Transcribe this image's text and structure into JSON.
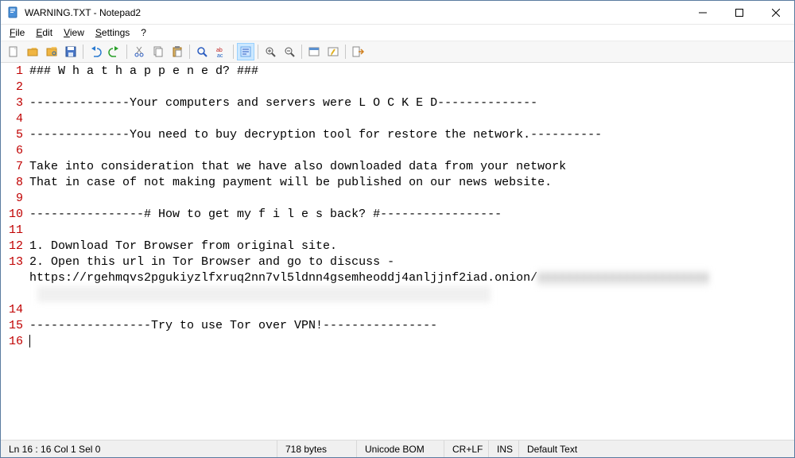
{
  "window": {
    "title": "WARNING.TXT - Notepad2"
  },
  "menu": {
    "file": "File",
    "edit": "Edit",
    "view": "View",
    "settings": "Settings",
    "help": "?"
  },
  "content": {
    "lines": [
      "### W h a t h a p p e n e d? ###",
      "",
      "--------------Your computers and servers were L O C K E D--------------",
      "",
      "--------------You need to buy decryption tool for restore the network.----------",
      "",
      "Take into consideration that we have also downloaded data from your network",
      "That in case of not making payment will be published on our news website.",
      "",
      "----------------# How to get my f i l e s back? #-----------------",
      "",
      "1. Download Tor Browser from original site.",
      "2. Open this url in Tor Browser and go to discuss -\nhttps://rgehmqvs2pgukiyzlfxruq2nn7vl5ldnn4gsemheoddj4anljjnf2iad.onion/",
      "",
      "-----------------Try to use Tor over VPN!----------------",
      ""
    ]
  },
  "status": {
    "pos": "Ln 16 : 16   Col 1   Sel 0",
    "bytes": "718 bytes",
    "encoding": "Unicode BOM",
    "eol": "CR+LF",
    "mode": "INS",
    "scheme": "Default Text"
  }
}
